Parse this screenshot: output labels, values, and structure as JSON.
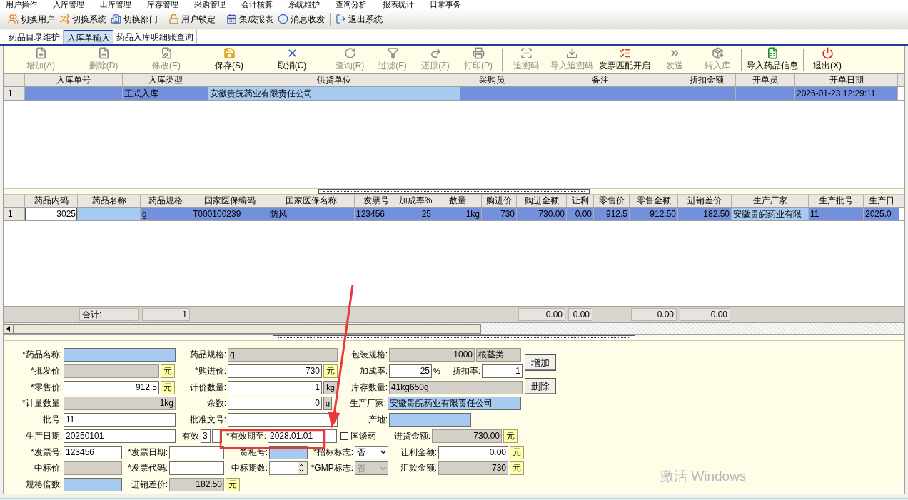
{
  "menu_bar": [
    "用户操作",
    "入库管理",
    "出库管理",
    "库存管理",
    "采购管理",
    "会计核算",
    "系统维护",
    "查询分析",
    "报表统计",
    "日常事务"
  ],
  "quick_toolbar": [
    [
      "切换用户",
      "切换系统",
      "切换部门"
    ],
    [
      "用户锁定"
    ],
    [
      "集成报表",
      "消息收发"
    ],
    [
      "退出系统"
    ]
  ],
  "tabs": [
    {
      "label": "药品目录维护",
      "selected": false
    },
    {
      "label": "入库单输入",
      "selected": true
    },
    {
      "label": "药品入库明细账查询",
      "selected": false
    }
  ],
  "action_toolbar": [
    [
      {
        "label": "增加(A)",
        "disabled": true
      },
      {
        "label": "删除(D)",
        "disabled": true
      },
      {
        "label": "修改(E)",
        "disabled": true
      },
      {
        "label": "保存(S)",
        "disabled": false
      },
      {
        "label": "取消(C)",
        "disabled": false
      }
    ],
    [
      {
        "label": "查询(R)",
        "disabled": true
      },
      {
        "label": "过滤(F)",
        "disabled": true
      },
      {
        "label": "还原(Z)",
        "disabled": true
      },
      {
        "label": "打印(P)",
        "disabled": true
      }
    ],
    [
      {
        "label": "追溯码",
        "disabled": true
      },
      {
        "label": "导入追溯码",
        "disabled": true
      },
      {
        "label": "发票匹配开启",
        "disabled": false
      },
      {
        "label": "发送",
        "disabled": true
      },
      {
        "label": "转入库",
        "disabled": true
      }
    ],
    [
      {
        "label": "导入药品信息",
        "disabled": false
      }
    ],
    [
      {
        "label": "退出(X)",
        "disabled": false
      }
    ]
  ],
  "order_grid": {
    "columns": [
      {
        "label": "入库单号",
        "lookup": false
      },
      {
        "label": "入库类型",
        "lookup": false
      },
      {
        "label": "供货单位",
        "lookup": true
      },
      {
        "label": "采购员",
        "lookup": false
      },
      {
        "label": "备注",
        "lookup": false
      },
      {
        "label": "折扣金额",
        "lookup": false
      },
      {
        "label": "开单员",
        "lookup": false
      },
      {
        "label": "开单日期",
        "lookup": false
      }
    ],
    "rows": [
      {
        "row_header": "1",
        "selected": true,
        "cells": [
          null,
          "正式入库",
          "安徽贵皖药业有限责任公司",
          null,
          null,
          null,
          null,
          "2026-01-23 12:29:11"
        ]
      }
    ]
  },
  "item_grid": {
    "columns": [
      {
        "label": "药品内码",
        "lookup": false,
        "numeric": true
      },
      {
        "label": "药品名称",
        "lookup": true,
        "numeric": false,
        "total": "合计:"
      },
      {
        "label": "药品规格",
        "lookup": false,
        "numeric": false,
        "total": "1"
      },
      {
        "label": "国家医保编码",
        "lookup": false,
        "numeric": false
      },
      {
        "label": "国家医保名称",
        "lookup": false,
        "numeric": false
      },
      {
        "label": "发票号",
        "lookup": false,
        "numeric": false
      },
      {
        "label": "加成率%",
        "lookup": false,
        "numeric": true
      },
      {
        "label": "数量",
        "lookup": false,
        "numeric": true
      },
      {
        "label": "购进价",
        "lookup": false,
        "numeric": true
      },
      {
        "label": "购进金额",
        "lookup": false,
        "numeric": true,
        "total": "0.00"
      },
      {
        "label": "让利",
        "lookup": false,
        "numeric": true,
        "total": "0.00"
      },
      {
        "label": "零售价",
        "lookup": false,
        "numeric": true
      },
      {
        "label": "零售金额",
        "lookup": false,
        "numeric": true,
        "total": "0.00"
      },
      {
        "label": "进销差价",
        "lookup": false,
        "numeric": true,
        "total": "0.00"
      },
      {
        "label": "生产厂家",
        "lookup": true,
        "numeric": false
      },
      {
        "label": "生产批号",
        "lookup": false,
        "numeric": false
      },
      {
        "label": "生产日",
        "lookup": false,
        "numeric": false
      }
    ],
    "rows": [
      {
        "row_header": "1",
        "selected": true,
        "cells": [
          {
            "text": "3025",
            "editing": true
          },
          {
            "editing": false
          },
          {
            "text": "g",
            "editing": false
          },
          {
            "text": "T000100239",
            "editing": false
          },
          {
            "text": "防风",
            "editing": false
          },
          {
            "text": "123456",
            "editing": false
          },
          {
            "text": "25",
            "editing": false
          },
          {
            "text": "1kg",
            "editing": false
          },
          {
            "text": "730",
            "editing": false
          },
          {
            "text": "730.00",
            "editing": false
          },
          {
            "text": "0.00",
            "editing": false
          },
          {
            "text": "912.5",
            "editing": false
          },
          {
            "text": "912.50",
            "editing": false
          },
          {
            "text": "182.50",
            "editing": false
          },
          {
            "text": "安徽贵皖药业有限",
            "editing": false
          },
          {
            "text": "11",
            "editing": false
          },
          {
            "text": "2025.0",
            "editing": false
          }
        ]
      }
    ]
  },
  "form": {
    "fields": [
      {
        "label": "*药品名称:",
        "controls": [
          {
            "kind": "text_field",
            "readonly": false,
            "highlighted": true
          }
        ]
      },
      {
        "label": "药品规格:",
        "controls": [
          {
            "kind": "text_field",
            "value": "g",
            "readonly": true,
            "highlighted": false
          }
        ]
      },
      {
        "label": "包装规格:",
        "controls": [
          {
            "kind": "number_field",
            "value": "1000",
            "readonly": true,
            "highlighted": false
          },
          {
            "kind": "text_field",
            "value": "根茎类",
            "readonly": true,
            "highlighted": false
          }
        ]
      },
      {
        "label": "*批发价:",
        "controls": [
          {
            "kind": "number_field",
            "readonly": true,
            "highlighted": false
          },
          {
            "kind": "currency_tag",
            "text": "元"
          }
        ]
      },
      {
        "label": "*购进价:",
        "controls": [
          {
            "kind": "number_field",
            "value": "730",
            "readonly": false,
            "highlighted": false
          },
          {
            "kind": "currency_tag",
            "text": "元"
          }
        ]
      },
      {
        "label": "加成率:",
        "controls": [
          {
            "kind": "number_field",
            "value": "25",
            "readonly": false,
            "highlighted": false
          },
          {
            "kind": "suffix",
            "text": "%"
          }
        ]
      },
      {
        "label": "折扣率:",
        "controls": [
          {
            "kind": "number_field",
            "value": "1",
            "readonly": false,
            "highlighted": false
          }
        ]
      },
      {
        "label": "*零售价:",
        "controls": [
          {
            "kind": "number_field",
            "value": "912.5",
            "readonly": false,
            "highlighted": false
          },
          {
            "kind": "currency_tag",
            "text": "元"
          }
        ]
      },
      {
        "label": "计价数量:",
        "controls": [
          {
            "kind": "number_field",
            "value": "1",
            "readonly": false,
            "highlighted": false
          },
          {
            "kind": "unit_box",
            "text": "kg"
          }
        ]
      },
      {
        "label": "库存数量:",
        "controls": [
          {
            "kind": "text_field",
            "value": "41kg650g",
            "readonly": true,
            "highlighted": false
          }
        ]
      },
      {
        "label": "*计量数量:",
        "controls": [
          {
            "kind": "number_field",
            "value": "1kg",
            "readonly": true,
            "highlighted": false
          }
        ]
      },
      {
        "label": "余数:",
        "controls": [
          {
            "kind": "number_field",
            "value": "0",
            "readonly": false,
            "highlighted": false
          },
          {
            "kind": "unit_box",
            "text": "g"
          }
        ]
      },
      {
        "label": "生产厂家:",
        "controls": [
          {
            "kind": "text_field",
            "value": "安徽贵皖药业有限责任公司",
            "readonly": false,
            "highlighted": true
          }
        ]
      },
      {
        "label": "批号:",
        "controls": [
          {
            "kind": "text_field",
            "value": "11",
            "readonly": false,
            "highlighted": false
          }
        ]
      },
      {
        "label": "批准文号:",
        "controls": [
          {
            "kind": "text_field",
            "readonly": false,
            "highlighted": false
          }
        ]
      },
      {
        "label": "产地:",
        "controls": [
          {
            "kind": "text_field",
            "readonly": false,
            "highlighted": true
          }
        ]
      },
      {
        "label": "生产日期:",
        "controls": [
          {
            "kind": "text_field",
            "value": "20250101",
            "readonly": false,
            "highlighted": false
          }
        ]
      },
      {
        "label": "有效",
        "controls": [
          {
            "kind": "text_field",
            "value": "3",
            "readonly": false,
            "highlighted": false
          },
          {
            "kind": "text_field",
            "readonly": false,
            "highlighted": false
          }
        ]
      },
      {
        "label": "*有效期至:",
        "controls": [
          {
            "kind": "text_field",
            "value": "2028.01.01",
            "readonly": false,
            "highlighted": false
          }
        ]
      },
      {
        "controls": [
          {
            "kind": "checkbox",
            "text": "国谈药",
            "checked": false
          }
        ]
      },
      {
        "label": "进货金额:",
        "controls": [
          {
            "kind": "number_field",
            "value": "730.00",
            "readonly": true,
            "highlighted": false
          },
          {
            "kind": "currency_tag",
            "text": "元"
          }
        ]
      },
      {
        "label": "*发票号:",
        "controls": [
          {
            "kind": "text_field",
            "value": "123456",
            "readonly": false,
            "highlighted": false
          }
        ]
      },
      {
        "label": "*发票日期:",
        "controls": [
          {
            "kind": "text_field",
            "readonly": false,
            "highlighted": false
          }
        ]
      },
      {
        "label": "货柜号:",
        "controls": [
          {
            "kind": "text_field",
            "readonly": false,
            "highlighted": true
          }
        ]
      },
      {
        "label": "*招标标志:",
        "controls": [
          {
            "kind": "select",
            "value": "否",
            "disabled": false
          }
        ]
      },
      {
        "label": "让利金额:",
        "controls": [
          {
            "kind": "number_field",
            "value": "0.00",
            "readonly": false,
            "highlighted": false
          },
          {
            "kind": "currency_tag",
            "text": "元"
          }
        ]
      },
      {
        "label": "中标价:",
        "controls": [
          {
            "kind": "number_field",
            "readonly": true,
            "highlighted": false
          }
        ]
      },
      {
        "label": "*发票代码:",
        "controls": [
          {
            "kind": "text_field",
            "readonly": false,
            "highlighted": false
          }
        ]
      },
      {
        "label": "中标期数:",
        "controls": [
          {
            "kind": "spinner"
          }
        ]
      },
      {
        "label": "*GMP标志:",
        "controls": [
          {
            "kind": "select",
            "value": "否",
            "disabled": true
          }
        ]
      },
      {
        "label": "汇款金额:",
        "controls": [
          {
            "kind": "number_field",
            "value": "730",
            "readonly": true,
            "highlighted": false
          },
          {
            "kind": "currency_tag",
            "text": "元"
          }
        ]
      },
      {
        "label": "规格倍数:",
        "controls": [
          {
            "kind": "text_field",
            "readonly": false,
            "highlighted": true
          }
        ]
      },
      {
        "label": "进销差价:",
        "controls": [
          {
            "kind": "number_field",
            "value": "182.50",
            "readonly": true,
            "highlighted": false
          },
          {
            "kind": "currency_tag",
            "text": "元"
          }
        ]
      }
    ],
    "buttons": [
      "增加",
      "删除"
    ]
  },
  "activation_notice": "激活 Windows"
}
